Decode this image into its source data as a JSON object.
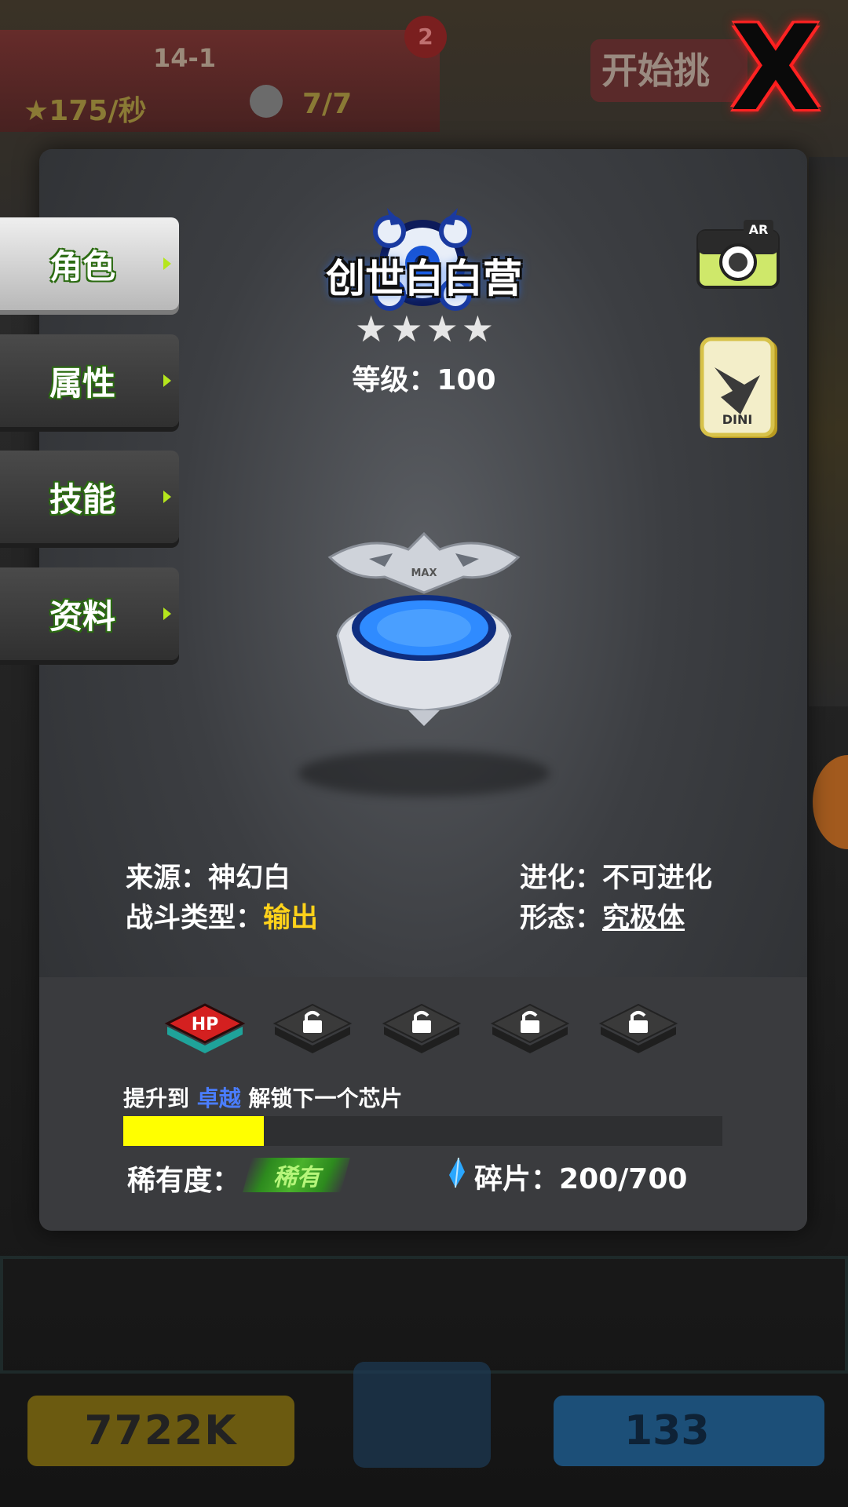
{
  "background": {
    "stage": "14-1",
    "star_rate": "★175/秒",
    "slots": "7/7",
    "badge": "2",
    "start_button": "开始挑",
    "left_counter": "7722K",
    "right_counter": "133"
  },
  "close_label": "X",
  "tabs": [
    {
      "label": "角色",
      "active": true
    },
    {
      "label": "属性",
      "active": false
    },
    {
      "label": "技能",
      "active": false
    },
    {
      "label": "资料",
      "active": false
    }
  ],
  "character": {
    "name": "创世白白营",
    "stars": 4,
    "level_label": "等级：",
    "level": "100"
  },
  "side_icons": {
    "ar_label": "AR",
    "card_label": "DINI"
  },
  "model_label": "MAX",
  "info": {
    "source_label": "来源：",
    "source": "神幻白",
    "battle_label": "战斗类型：",
    "battle": "输出",
    "evolve_label": "进化：",
    "evolve": "不可进化",
    "form_label": "形态：",
    "form": "究极体"
  },
  "chips": {
    "first_label": "HP",
    "locked_count": 4
  },
  "unlock": {
    "prefix": "提升到 ",
    "highlight": "卓越",
    "suffix": " 解锁下一个芯片",
    "progress_fraction": 0.235
  },
  "rarity": {
    "label": "稀有度：",
    "value": "稀有"
  },
  "shards": {
    "label": "碎片：",
    "value": "200/700"
  },
  "colors": {
    "progress": "#ffff00",
    "battle_type": "#ffd21a",
    "highlight": "#4a7dff",
    "tab_outline": "#2a6a10",
    "rarity": "#4ab22c"
  }
}
